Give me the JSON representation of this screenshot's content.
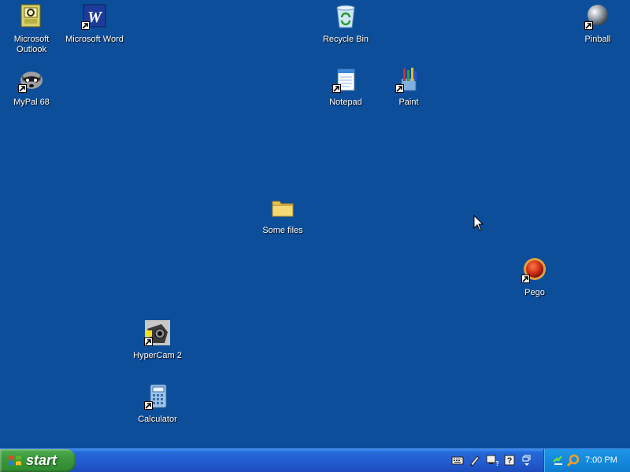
{
  "desktop": {
    "background": "#0c4e9a",
    "icons": [
      {
        "label": "Microsoft Outlook",
        "icon": "outlook-icon",
        "shortcut": false
      },
      {
        "label": "Microsoft Word",
        "icon": "word-icon",
        "shortcut": true
      },
      {
        "label": "Recycle Bin",
        "icon": "recycle-bin-icon",
        "shortcut": false
      },
      {
        "label": "Pinball",
        "icon": "pinball-icon",
        "shortcut": true
      },
      {
        "label": "MyPal 68",
        "icon": "mypal-icon",
        "shortcut": true
      },
      {
        "label": "Notepad",
        "icon": "notepad-icon",
        "shortcut": true
      },
      {
        "label": "Paint",
        "icon": "paint-icon",
        "shortcut": true
      },
      {
        "label": "Some files",
        "icon": "folder-icon",
        "shortcut": false
      },
      {
        "label": "Pego",
        "icon": "pego-icon",
        "shortcut": true
      },
      {
        "label": "HyperCam 2",
        "icon": "hypercam-icon",
        "shortcut": true
      },
      {
        "label": "Calculator",
        "icon": "calculator-icon",
        "shortcut": true
      }
    ]
  },
  "taskbar": {
    "start_label": "start",
    "quick_launch": [
      "keyboard-icon",
      "pen-icon",
      "monitor-help-icon",
      "help-icon",
      "language-bar-icon"
    ],
    "tray_icons": [
      "network-icon",
      "search-icon"
    ],
    "clock": "7:00 PM"
  }
}
